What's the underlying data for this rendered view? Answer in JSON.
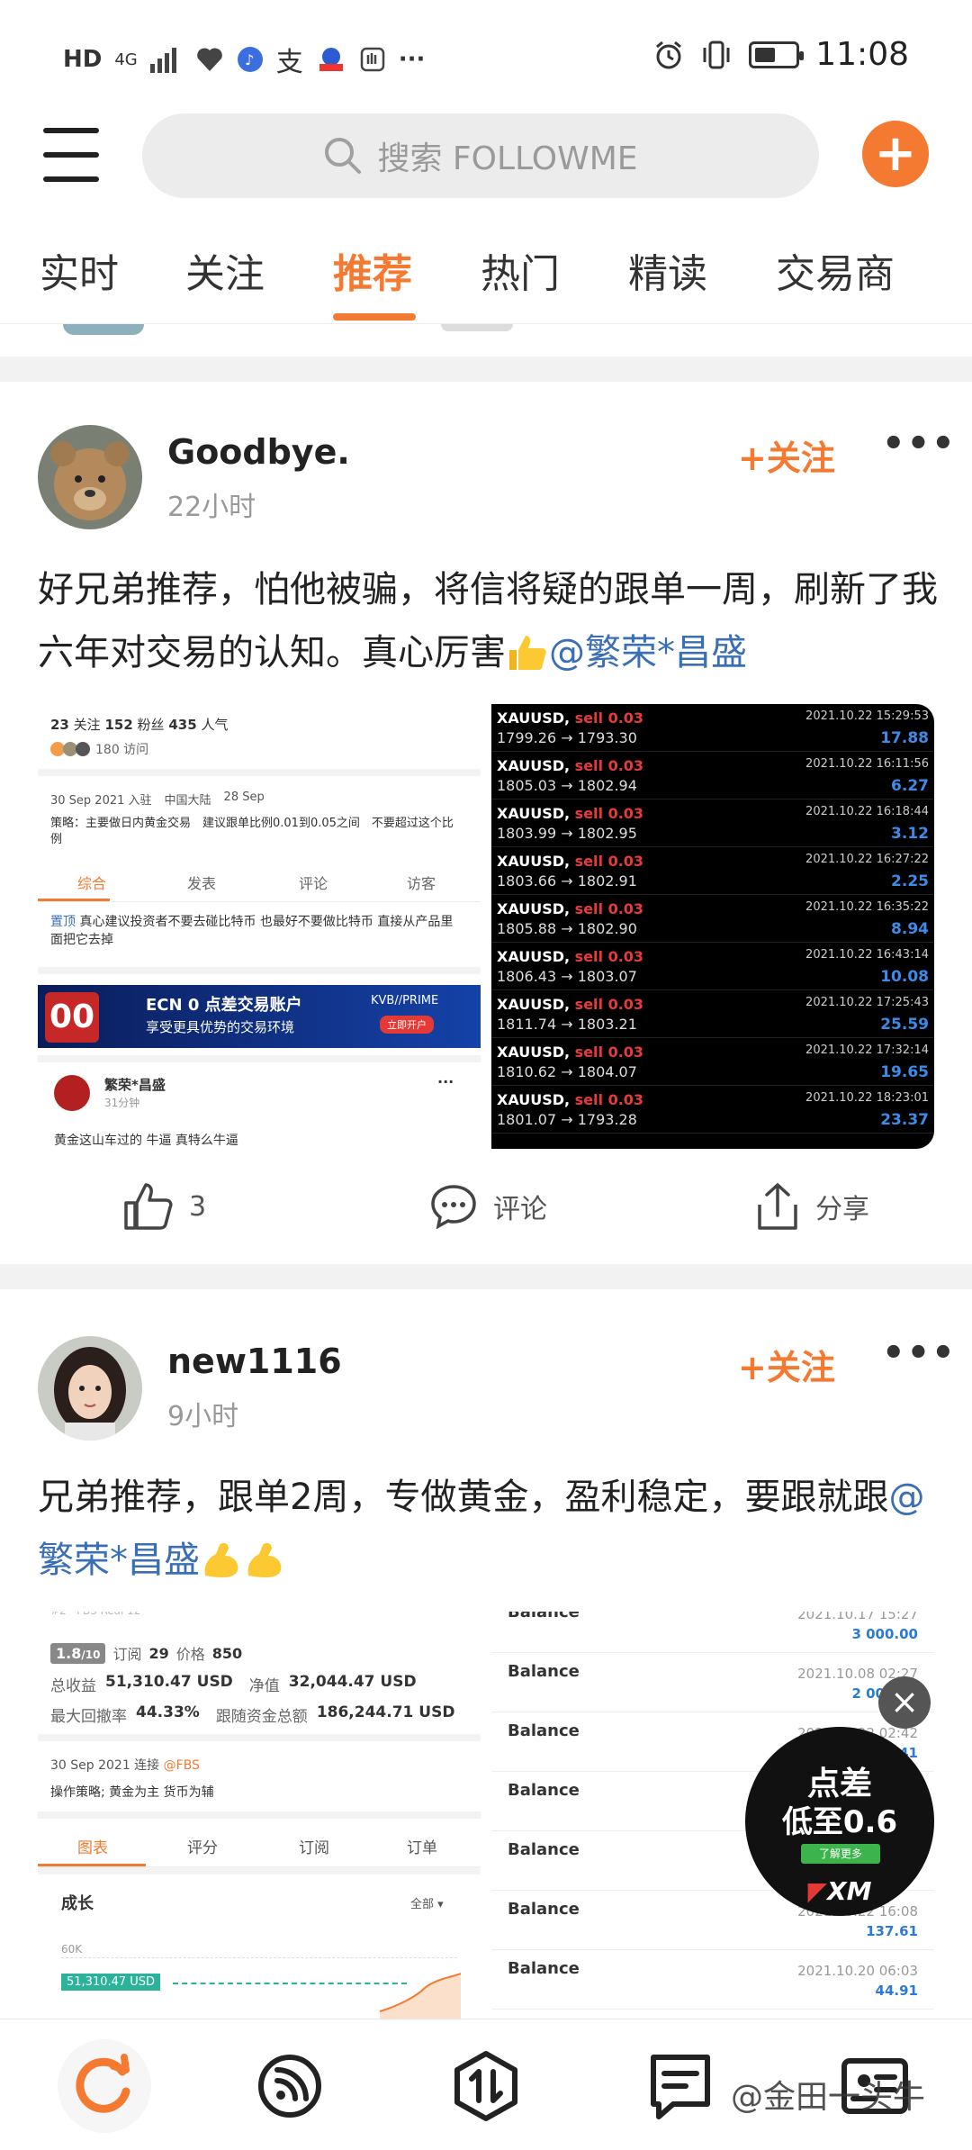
{
  "status_bar": {
    "left_labels": [
      "HD",
      "4G"
    ],
    "time": "11:08"
  },
  "header": {
    "search_placeholder": "搜索 FOLLOWME"
  },
  "tabs": [
    "实时",
    "关注",
    "推荐",
    "热门",
    "精读",
    "交易商"
  ],
  "active_tab": "推荐",
  "posts": [
    {
      "user": "Goodbye.",
      "time": "22小时",
      "follow": "+关注",
      "text": "好兄弟推荐，怕他被骗，将信将疑的跟单一周，刷新了我六年对交易的认知。真心厉害",
      "mention": "@繁荣*昌盛",
      "like_count": "3",
      "comment_label": "评论",
      "share_label": "分享",
      "profile": {
        "stats": [
          "23",
          "关注",
          "152",
          "粉丝",
          "435",
          "人气"
        ],
        "visits": "180 访问",
        "joined": "30 Sep 2021 入驻",
        "location": "中国大陆",
        "birthday": "28 Sep",
        "strategy": "策略：主要做日内黄金交易　建议跟单比例0.01到0.05之间　不要超过这个比例",
        "tabs": [
          "综合",
          "发表",
          "评论",
          "访客"
        ],
        "pinned_tag": "置顶",
        "pinned_text": "真心建议投资者不要去碰比特币 也最好不要做比特币 直接从产品里面把它去掉",
        "banner_title": "ECN 0 点差交易账户",
        "banner_sub": "享受更具优势的交易环境",
        "banner_brand": "KVB//PRIME",
        "banner_btn": "立即开户",
        "sub_user": "繁荣*昌盛",
        "sub_time": "31分钟",
        "sub_text": "黄金这山车过的 牛逼 真特么牛逼"
      },
      "trades": [
        {
          "sym": "XAUUSD,",
          "side": "sell 0.03",
          "prices": "1799.26 → 1793.30",
          "date": "2021.10.22 15:29:53",
          "profit": "17.88"
        },
        {
          "sym": "XAUUSD,",
          "side": "sell 0.03",
          "prices": "1805.03 → 1802.94",
          "date": "2021.10.22 16:11:56",
          "profit": "6.27"
        },
        {
          "sym": "XAUUSD,",
          "side": "sell 0.03",
          "prices": "1803.99 → 1802.95",
          "date": "2021.10.22 16:18:44",
          "profit": "3.12"
        },
        {
          "sym": "XAUUSD,",
          "side": "sell 0.03",
          "prices": "1803.66 → 1802.91",
          "date": "2021.10.22 16:27:22",
          "profit": "2.25"
        },
        {
          "sym": "XAUUSD,",
          "side": "sell 0.03",
          "prices": "1805.88 → 1802.90",
          "date": "2021.10.22 16:35:22",
          "profit": "8.94"
        },
        {
          "sym": "XAUUSD,",
          "side": "sell 0.03",
          "prices": "1806.43 → 1803.07",
          "date": "2021.10.22 16:43:14",
          "profit": "10.08"
        },
        {
          "sym": "XAUUSD,",
          "side": "sell 0.03",
          "prices": "1811.74 → 1803.21",
          "date": "2021.10.22 17:25:43",
          "profit": "25.59"
        },
        {
          "sym": "XAUUSD,",
          "side": "sell 0.03",
          "prices": "1810.62 → 1804.07",
          "date": "2021.10.22 17:32:14",
          "profit": "19.65"
        },
        {
          "sym": "XAUUSD,",
          "side": "sell 0.03",
          "prices": "1801.07 → 1793.28",
          "date": "2021.10.22 18:23:01",
          "profit": "23.37"
        }
      ]
    },
    {
      "user": "new1116",
      "time": "9小时",
      "follow": "+关注",
      "text": "兄弟推荐，跟单2周，专做黄金，盈利稳定，要跟就跟",
      "mention": "@繁荣*昌盛",
      "account": {
        "rating": "1.8",
        "rating_max": "/10",
        "subs_label": "订阅",
        "subs": "29",
        "price_label": "价格",
        "price": "850",
        "profit_label": "总收益",
        "profit": "51,310.47 USD",
        "equity_label": "净值",
        "equity": "32,044.47 USD",
        "dd_label": "最大回撤率",
        "dd": "44.33%",
        "follow_amt_label": "跟随资金总额",
        "follow_amt": "186,244.71 USD",
        "joined": "30 Sep 2021 连接",
        "broker": "@FBS",
        "strategy": "操作策略; 黄金为主 货币为辅",
        "tabs": [
          "图表",
          "评分",
          "订阅",
          "订单"
        ],
        "growth": "成长",
        "all": "全部 ▾",
        "axis": "60K",
        "marker": "51,310.47 USD"
      },
      "balances": [
        {
          "label": "Balance",
          "date": "2021.10.17 15:27",
          "amount": "3 000.00"
        },
        {
          "label": "Balance",
          "date": "2021.10.08 02:27",
          "amount": "2 000.00"
        },
        {
          "label": "Balance",
          "date": "2021.10.22 02:42",
          "amount": "41"
        },
        {
          "label": "Balance",
          "date": "",
          "amount": ""
        },
        {
          "label": "Balance",
          "date": "",
          "amount": ""
        },
        {
          "label": "Balance",
          "date": "2021.10.22 16:08",
          "amount": "137.61"
        },
        {
          "label": "Balance",
          "date": "2021.10.20 06:03",
          "amount": "44.91"
        }
      ]
    }
  ],
  "ad": {
    "line1": "点差",
    "line2": "低至0.6",
    "button": "了解更多",
    "brand": "XM"
  },
  "watermark": "@金田一头牛"
}
